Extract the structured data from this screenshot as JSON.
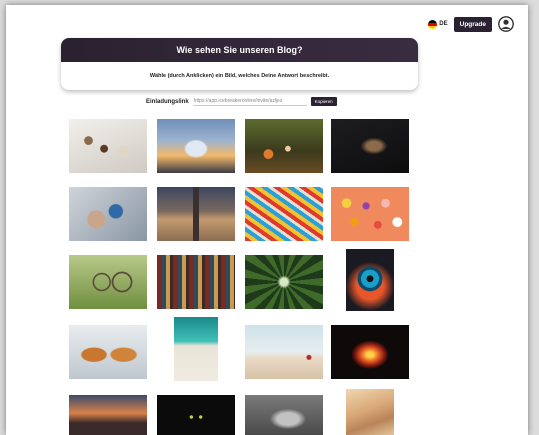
{
  "topbar": {
    "language_code": "DE",
    "upgrade_label": "Upgrade"
  },
  "header": {
    "title": "Wie sehen Sie unseren Blog?",
    "subtitle": "Wähle (durch Anklicken) ein Bild, welches Deine Antwort beschreibt."
  },
  "invite": {
    "label": "Einladungslink",
    "url": "https://app.icebreakeronline/invite/azljez",
    "copy_label": "Kopieren"
  },
  "images": [
    {
      "name": "image-coffee-table"
    },
    {
      "name": "image-jar-sunset"
    },
    {
      "name": "image-forest-mushrooms"
    },
    {
      "name": "image-dark-figure"
    },
    {
      "name": "image-painted-hands"
    },
    {
      "name": "image-hourglass-beach"
    },
    {
      "name": "image-colorful-threads"
    },
    {
      "name": "image-donuts"
    },
    {
      "name": "image-glasses-field"
    },
    {
      "name": "image-bookshelf"
    },
    {
      "name": "image-forest-canopy"
    },
    {
      "name": "image-eye-closeup"
    },
    {
      "name": "image-two-foxes"
    },
    {
      "name": "image-aerial-beach"
    },
    {
      "name": "image-beach-person"
    },
    {
      "name": "image-fire-guitar"
    },
    {
      "name": "image-sunset-city"
    },
    {
      "name": "image-black-cat"
    },
    {
      "name": "image-hands-together"
    },
    {
      "name": "image-sand-dunes"
    }
  ],
  "colors": {
    "header_band": "#2a2230",
    "button": "#2a2233"
  }
}
